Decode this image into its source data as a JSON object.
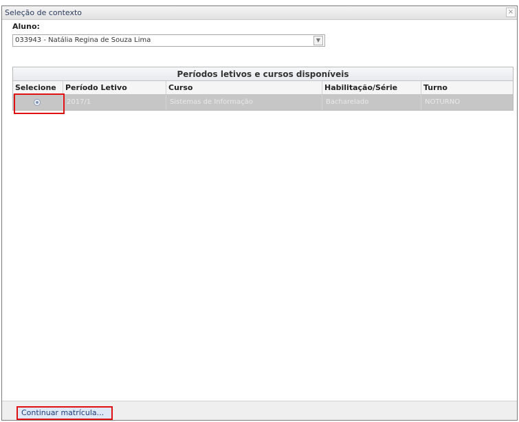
{
  "dialog": {
    "title": "Seleção de contexto",
    "close_glyph": "×"
  },
  "student": {
    "label": "Aluno:",
    "selected": "033943 - Natália Regina de Souza Lima"
  },
  "grid": {
    "caption": "Períodos letivos e cursos disponíveis",
    "columns": [
      "Selecione",
      "Período Letivo",
      "Curso",
      "Habilitação/Série",
      "Turno"
    ],
    "rows": [
      {
        "selected": true,
        "periodo": "2017/1",
        "curso": "Sistemas de Informação",
        "habilitacao": "Bacharelado",
        "turno": "NOTURNO"
      }
    ]
  },
  "footer": {
    "continue_label": "Continuar matrícula..."
  },
  "colors": {
    "highlight": "#e01010",
    "selected_row": "#c6c6c6"
  }
}
